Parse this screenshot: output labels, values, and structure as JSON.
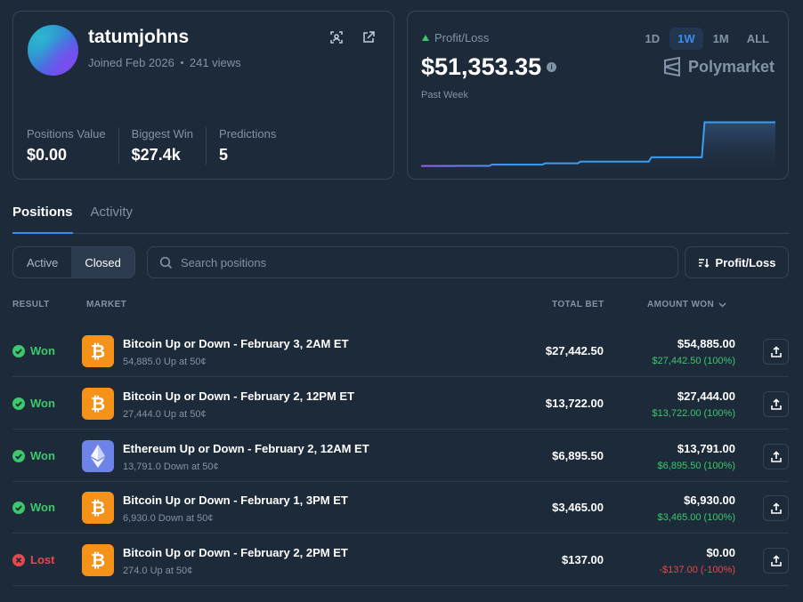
{
  "profile": {
    "username": "tatumjohns",
    "joined": "Joined Feb 2026",
    "views": "241 views",
    "stats": [
      {
        "label": "Positions Value",
        "value": "$0.00"
      },
      {
        "label": "Biggest Win",
        "value": "$27.4k"
      },
      {
        "label": "Predictions",
        "value": "5"
      }
    ],
    "icons": [
      "scan-icon",
      "external-link-icon"
    ]
  },
  "pnl": {
    "label": "Profit/Loss",
    "value": "$51,353.35",
    "info_glyph": "i",
    "period": "Past Week",
    "ranges": [
      "1D",
      "1W",
      "1M",
      "ALL"
    ],
    "active_range": "1W",
    "brand": "Polymarket",
    "colors": {
      "up": "#3cc86b",
      "line_start": "#9b5cf0",
      "line_end": "#3a9df0"
    }
  },
  "chart_data": {
    "type": "area",
    "x": [
      0,
      1,
      2,
      3,
      4,
      5,
      6,
      7,
      8,
      9,
      10,
      11,
      12,
      13,
      14,
      15,
      16,
      17,
      18,
      19,
      20
    ],
    "values": [
      400,
      400,
      500,
      500,
      2000,
      2000,
      2000,
      3500,
      3500,
      5500,
      5500,
      5500,
      5500,
      10500,
      10500,
      10500,
      51353.35,
      51353.35,
      51353.35,
      51353.35,
      51353.35
    ],
    "ylim": [
      0,
      55000
    ]
  },
  "tabs": [
    {
      "label": "Positions",
      "active": true
    },
    {
      "label": "Activity",
      "active": false
    }
  ],
  "filters": {
    "active_label": "Active",
    "closed_label": "Closed",
    "search_placeholder": "Search positions",
    "sort_label": "Profit/Loss"
  },
  "table": {
    "columns": {
      "result": "RESULT",
      "market": "MARKET",
      "total_bet": "TOTAL BET",
      "amount_won": "AMOUNT WON"
    },
    "rows": [
      {
        "result": "Won",
        "coin": "btc",
        "title": "Bitcoin Up or Down - February 3, 2AM ET",
        "sub": "54,885.0 Up at 50¢",
        "bet": "$27,442.50",
        "won": "$54,885.00",
        "delta": "$27,442.50 (100%)"
      },
      {
        "result": "Won",
        "coin": "btc",
        "title": "Bitcoin Up or Down - February 2, 12PM ET",
        "sub": "27,444.0 Up at 50¢",
        "bet": "$13,722.00",
        "won": "$27,444.00",
        "delta": "$13,722.00 (100%)"
      },
      {
        "result": "Won",
        "coin": "eth",
        "title": "Ethereum Up or Down - February 2, 12AM ET",
        "sub": "13,791.0 Down at 50¢",
        "bet": "$6,895.50",
        "won": "$13,791.00",
        "delta": "$6,895.50 (100%)"
      },
      {
        "result": "Won",
        "coin": "btc",
        "title": "Bitcoin Up or Down - February 1, 3PM ET",
        "sub": "6,930.0 Down at 50¢",
        "bet": "$3,465.00",
        "won": "$6,930.00",
        "delta": "$3,465.00 (100%)"
      },
      {
        "result": "Lost",
        "coin": "btc",
        "title": "Bitcoin Up or Down - February 2, 2PM ET",
        "sub": "274.0 Up at 50¢",
        "bet": "$137.00",
        "won": "$0.00",
        "delta": "-$137.00 (-100%)"
      }
    ],
    "colors": {
      "won": "#3cc86b",
      "lost": "#e5484d",
      "btc": "#f5921a",
      "eth": "#6d83e8"
    }
  }
}
